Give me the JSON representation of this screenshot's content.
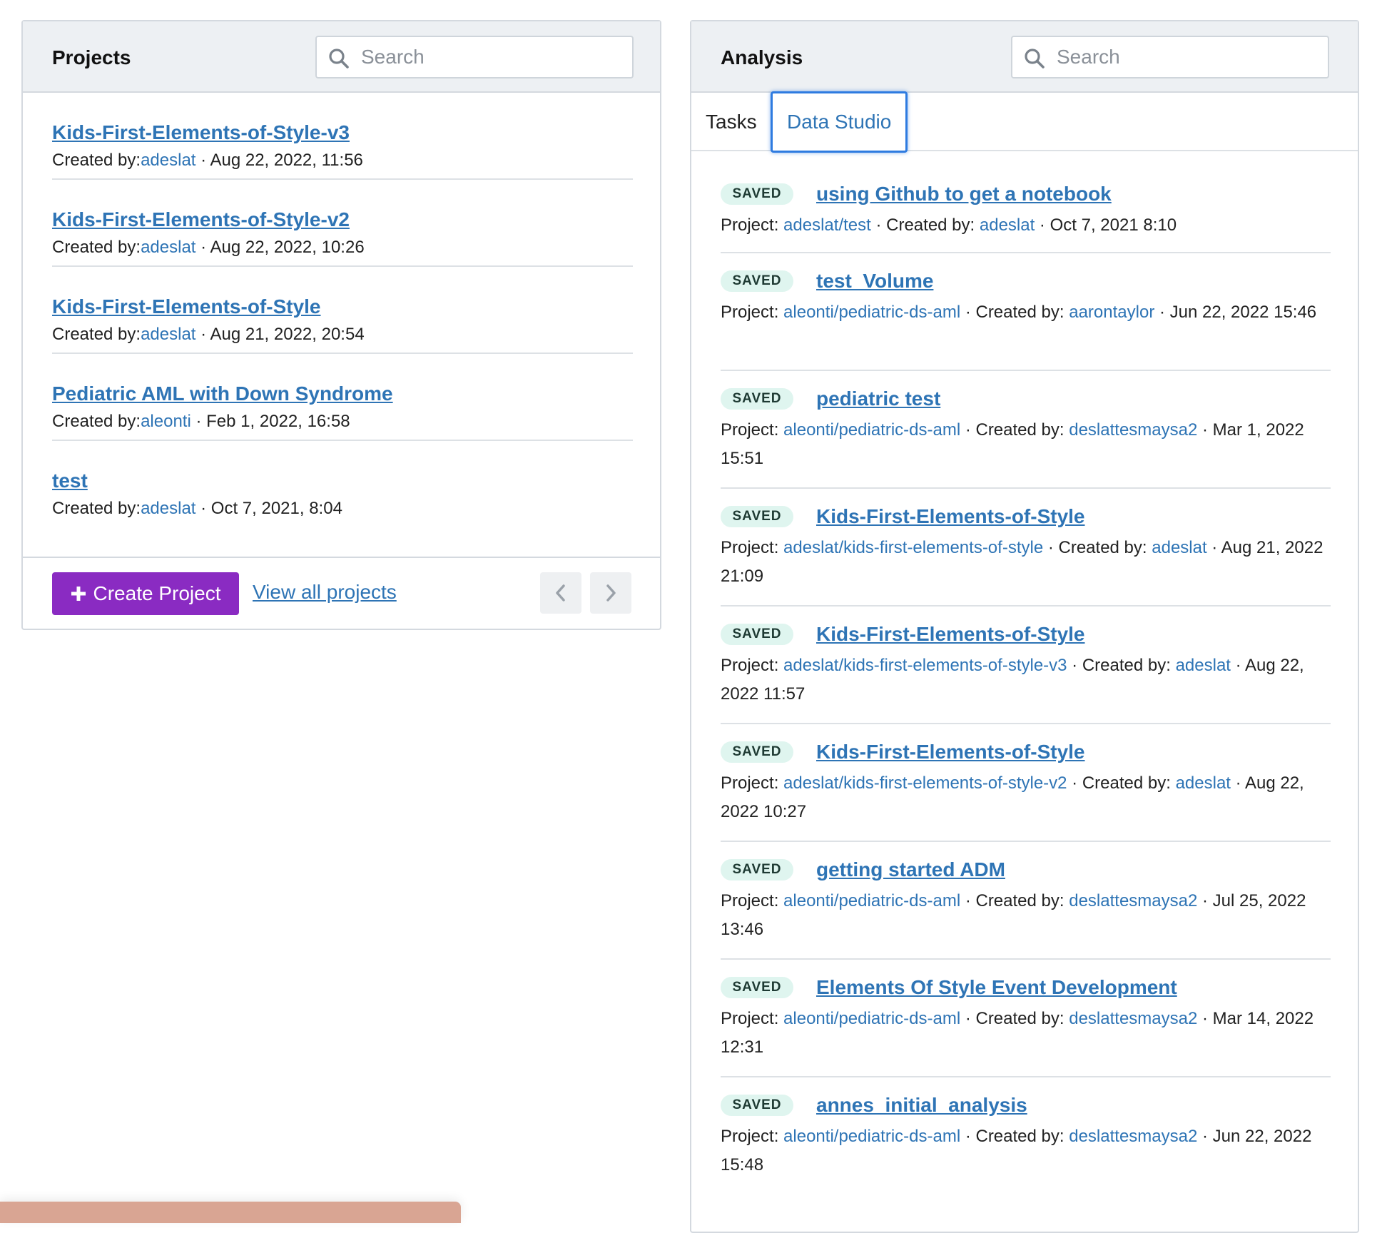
{
  "projects_panel": {
    "title": "Projects",
    "search_placeholder": "Search",
    "created_by_label": "Created by:",
    "items": [
      {
        "name": "Kids-First-Elements-of-Style-v3",
        "author": "adeslat",
        "date": "Aug 22, 2022, 11:56"
      },
      {
        "name": "Kids-First-Elements-of-Style-v2",
        "author": "adeslat",
        "date": "Aug 22, 2022, 10:26"
      },
      {
        "name": "Kids-First-Elements-of-Style",
        "author": "adeslat",
        "date": "Aug 21, 2022, 20:54"
      },
      {
        "name": "Pediatric AML with Down Syndrome",
        "author": "aleonti",
        "date": "Feb 1, 2022, 16:58"
      },
      {
        "name": "test",
        "author": "adeslat",
        "date": "Oct 7, 2021, 8:04"
      }
    ],
    "create_button": "Create Project",
    "view_all_link": "View all projects",
    "pager_prev_icon": "chevron-left-icon",
    "pager_next_icon": "chevron-right-icon"
  },
  "analysis_panel": {
    "title": "Analysis",
    "search_placeholder": "Search",
    "tabs": [
      {
        "label": "Tasks",
        "active": false
      },
      {
        "label": "Data Studio",
        "active": true
      }
    ],
    "project_label": "Project:",
    "created_by_label": "Created by:",
    "items": [
      {
        "status": "SAVED",
        "title": "using Github to get a notebook",
        "project": "adeslat/test",
        "author": "adeslat",
        "date": "Oct 7, 2021 8:10"
      },
      {
        "status": "SAVED",
        "title": "test_Volume",
        "project": "aleonti/pediatric-ds-aml",
        "author": "aarontaylor",
        "date": "Jun 22, 2022 15:46"
      },
      {
        "status": "SAVED",
        "title": "pediatric test",
        "project": "aleonti/pediatric-ds-aml",
        "author": "deslattesmaysa2",
        "date": "Mar 1, 2022 15:51"
      },
      {
        "status": "SAVED",
        "title": "Kids-First-Elements-of-Style",
        "project": "adeslat/kids-first-elements-of-style",
        "author": "adeslat",
        "date": "Aug 21, 2022 21:09"
      },
      {
        "status": "SAVED",
        "title": "Kids-First-Elements-of-Style",
        "project": "adeslat/kids-first-elements-of-style-v3",
        "author": "adeslat",
        "date": "Aug 22, 2022 11:57"
      },
      {
        "status": "SAVED",
        "title": "Kids-First-Elements-of-Style",
        "project": "adeslat/kids-first-elements-of-style-v2",
        "author": "adeslat",
        "date": "Aug 22, 2022 10:27"
      },
      {
        "status": "SAVED",
        "title": "getting started ADM",
        "project": "aleonti/pediatric-ds-aml",
        "author": "deslattesmaysa2",
        "date": "Jul 25, 2022 13:46"
      },
      {
        "status": "SAVED",
        "title": "Elements Of Style Event Development",
        "project": "aleonti/pediatric-ds-aml",
        "author": "deslattesmaysa2",
        "date": "Mar 14, 2022 12:31"
      },
      {
        "status": "SAVED",
        "title": "annes_initial_analysis",
        "project": "aleonti/pediatric-ds-aml",
        "author": "deslattesmaysa2",
        "date": "Jun 22, 2022 15:48"
      }
    ]
  },
  "colors": {
    "link": "#2e74b5",
    "primary_button": "#8a2bc2",
    "badge_bg": "#dff5ef",
    "header_bg": "#edf0f3",
    "active_tab_border": "#2e7be0"
  }
}
